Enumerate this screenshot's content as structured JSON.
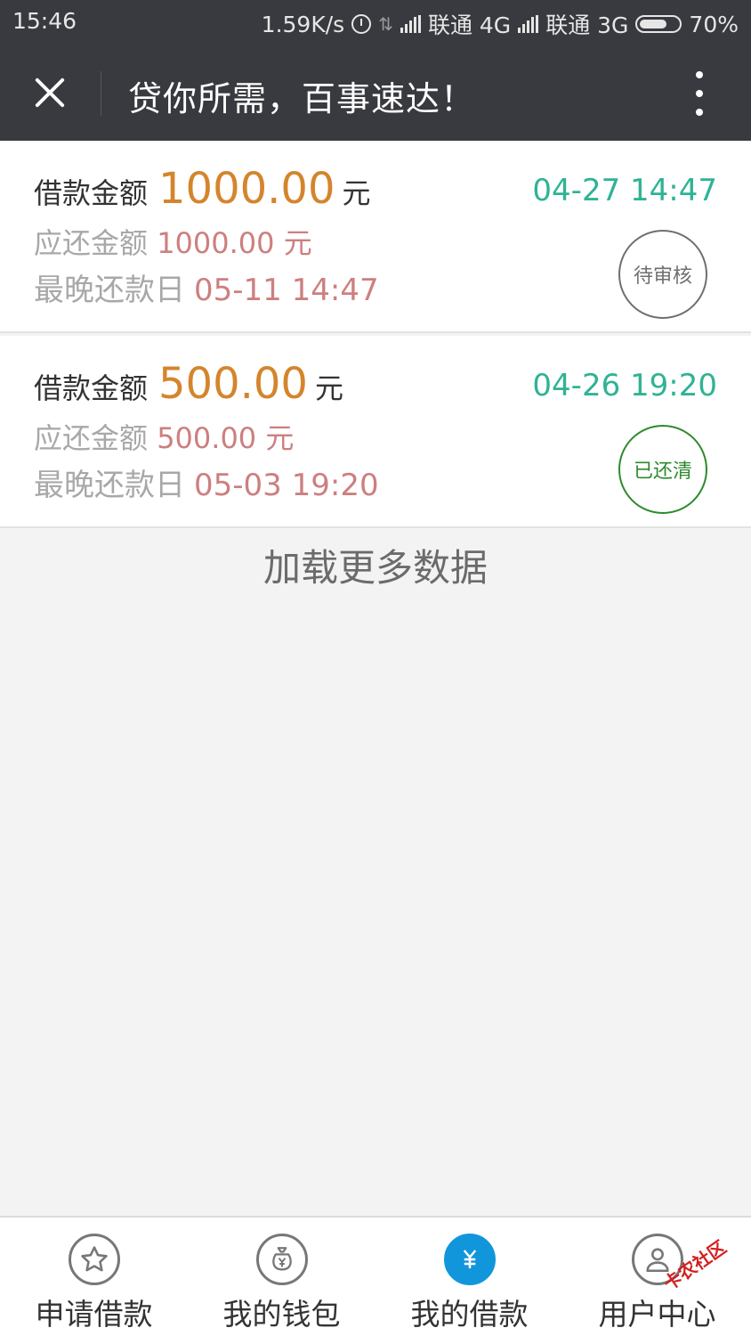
{
  "status_bar": {
    "time": "15:46",
    "speed": "1.59K/s",
    "carrier1": "联通 4G",
    "carrier2": "联通 3G",
    "battery": "70%"
  },
  "header": {
    "title": "贷你所需，百事速达！",
    "close_icon": "close-icon",
    "more_icon": "more-vertical-icon"
  },
  "loans": [
    {
      "amount_label": "借款金额",
      "amount": "1000.00",
      "unit": "元",
      "repay_label": "应还金额",
      "repay_amount": "1000.00 元",
      "deadline_label": "最晚还款日",
      "deadline": "05-11 14:47",
      "date": "04-27 14:47",
      "status": "待审核"
    },
    {
      "amount_label": "借款金额",
      "amount": "500.00",
      "unit": "元",
      "repay_label": "应还金额",
      "repay_amount": "500.00 元",
      "deadline_label": "最晚还款日",
      "deadline": "05-03 19:20",
      "date": "04-26 19:20",
      "status": "已还清"
    }
  ],
  "load_more": "加载更多数据",
  "tabs": [
    {
      "label": "申请借款",
      "icon": "star-icon"
    },
    {
      "label": "我的钱包",
      "icon": "money-bag-icon"
    },
    {
      "label": "我的借款",
      "icon": "yuan-icon"
    },
    {
      "label": "用户中心",
      "icon": "user-icon"
    }
  ],
  "watermark": "卡农社区",
  "colors": {
    "header_bg": "#393a3f",
    "amount": "#d4852c",
    "date": "#2fb394",
    "paid": "#2d8a2d",
    "active_tab": "#1296db"
  }
}
